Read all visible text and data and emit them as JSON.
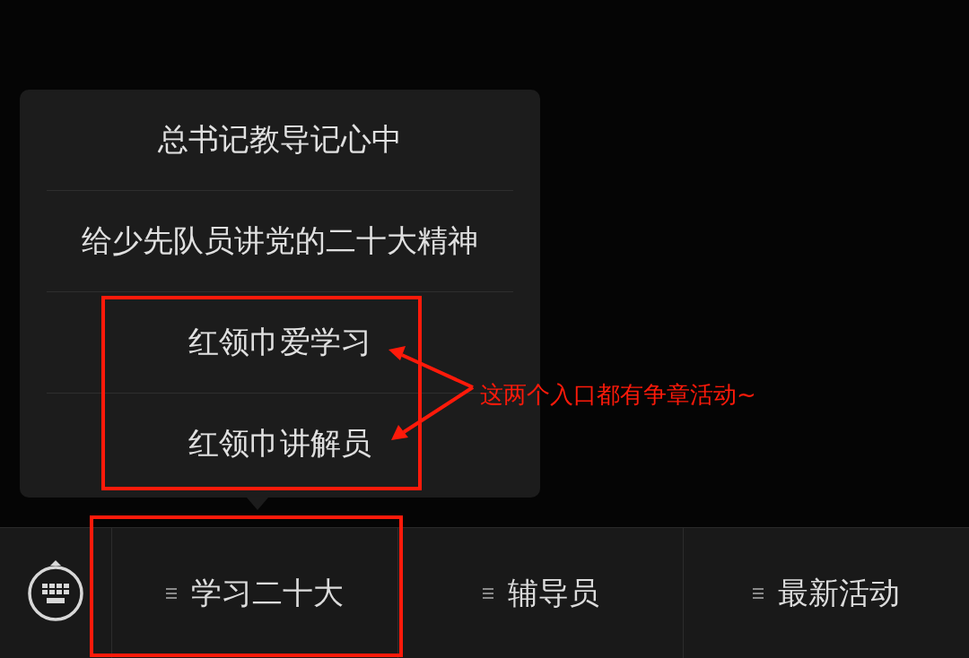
{
  "menu_bar": {
    "items": [
      {
        "label": "学习二十大",
        "submenu": [
          "总书记教导记心中",
          "给少先队员讲党的二十大精神",
          "红领巾爱学习",
          "红领巾讲解员"
        ]
      },
      {
        "label": "辅导员"
      },
      {
        "label": "最新活动"
      }
    ]
  },
  "annotation": {
    "text": "这两个入口都有争章活动~"
  }
}
